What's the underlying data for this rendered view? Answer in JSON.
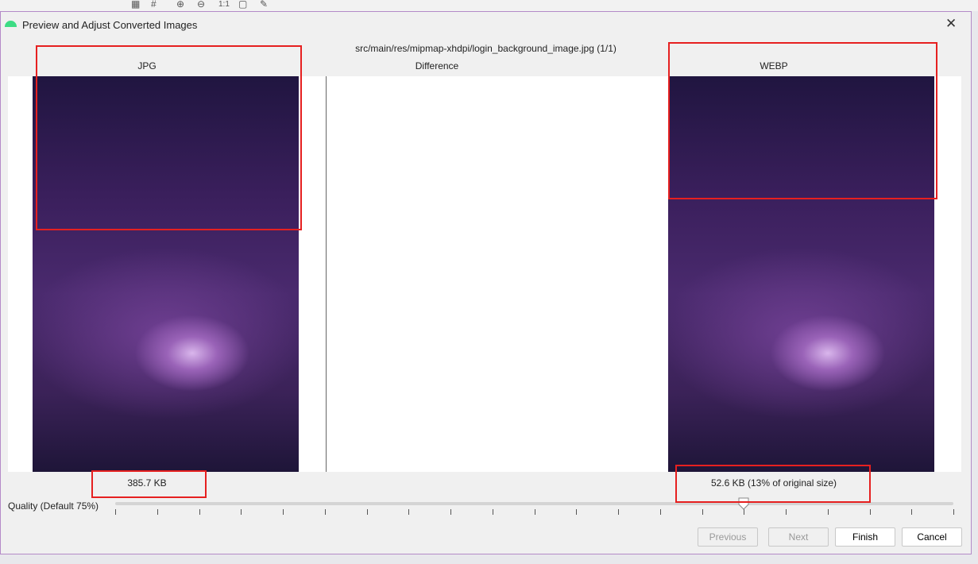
{
  "dialog": {
    "title": "Preview and Adjust Converted Images",
    "file_path": "src/main/res/mipmap-xhdpi/login_background_image.jpg (1/1)"
  },
  "columns": {
    "original": "JPG",
    "difference": "Difference",
    "converted": "WEBP"
  },
  "sizes": {
    "original": "385.7 KB",
    "converted": "52.6 KB (13% of original size)"
  },
  "quality": {
    "label": "Quality (Default 75%)",
    "value": 75,
    "min": 0,
    "max": 100
  },
  "buttons": {
    "previous": "Previous",
    "next": "Next",
    "finish": "Finish",
    "cancel": "Cancel"
  },
  "toolbar": {
    "actual_size": "1:1"
  },
  "colors": {
    "annotation": "#e62020",
    "accent": "#3ddc84"
  }
}
